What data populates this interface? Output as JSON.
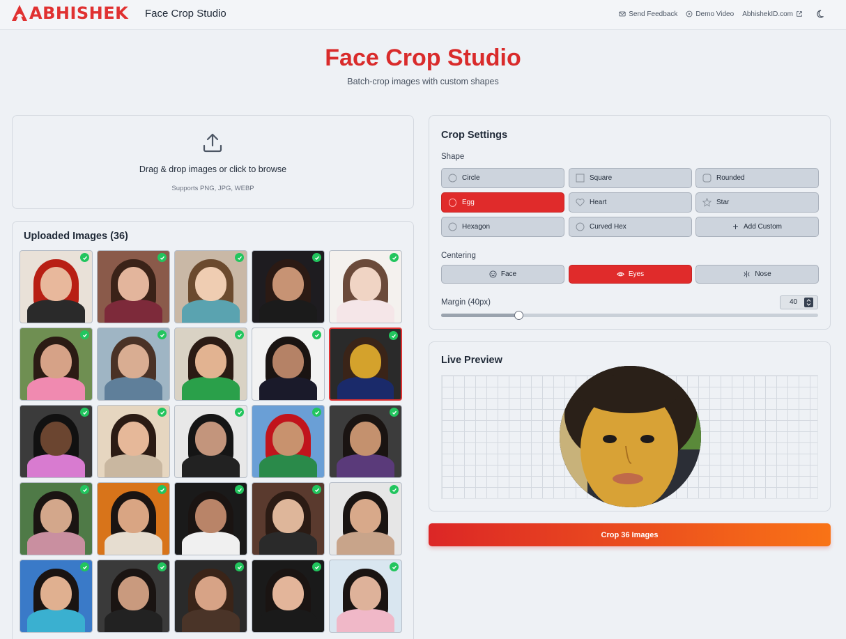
{
  "brand": {
    "logo_text": "ABHISHEK",
    "app_name": "Face Crop Studio"
  },
  "nav": {
    "feedback": "Send Feedback",
    "demo": "Demo Video",
    "site": "AbhishekID.com"
  },
  "hero": {
    "title": "Face Crop Studio",
    "subtitle": "Batch-crop images with custom shapes"
  },
  "upload": {
    "title": "Drag & drop images or click to browse",
    "subtitle": "Supports PNG, JPG, WEBP"
  },
  "gallery": {
    "title": "Uploaded Images (36)",
    "thumbnails": [
      {
        "bg": "#e9e1d8",
        "hair": "#b81f14",
        "skin": "#e8b89c",
        "shirt": "#2a2a2a"
      },
      {
        "bg": "#8a5a4a",
        "hair": "#3a2218",
        "skin": "#e3b59c",
        "shirt": "#7d2a3a"
      },
      {
        "bg": "#c9b8a6",
        "hair": "#6b4a2e",
        "skin": "#efcdb2",
        "shirt": "#5aa3b0"
      },
      {
        "bg": "#1e1c20",
        "hair": "#2b1a14",
        "skin": "#c79374",
        "shirt": "#1b1b1b"
      },
      {
        "bg": "#f4f1ee",
        "hair": "#6b4a3a",
        "skin": "#f0d4c4",
        "shirt": "#f5e6e8"
      },
      {
        "bg": "#6f8f52",
        "hair": "#2b1b14",
        "skin": "#d6a287",
        "shirt": "#f08ab0"
      },
      {
        "bg": "#9fb5c4",
        "hair": "#4a3226",
        "skin": "#d9ad92",
        "shirt": "#5f7f9a"
      },
      {
        "bg": "#d9d2c4",
        "hair": "#2b1b14",
        "skin": "#e2b391",
        "shirt": "#2aa04a"
      },
      {
        "bg": "#f2f2f2",
        "hair": "#1a1412",
        "skin": "#b58266",
        "shirt": "#1a1a2a"
      },
      {
        "bg": "#2a2a2a",
        "hair": "#3a2418",
        "skin": "#d4a22c",
        "shirt": "#1a2a6a"
      },
      {
        "bg": "#3b3b3b",
        "hair": "#111111",
        "skin": "#6b4530",
        "shirt": "#d87bd0"
      },
      {
        "bg": "#e6d6c0",
        "hair": "#2b1b14",
        "skin": "#e6b899",
        "shirt": "#c9b7a0"
      },
      {
        "bg": "#e8e8e8",
        "hair": "#151515",
        "skin": "#c3957c",
        "shirt": "#222222"
      },
      {
        "bg": "#6a9fd6",
        "hair": "#c1141c",
        "skin": "#c8926e",
        "shirt": "#2a8a4a"
      },
      {
        "bg": "#3c3c3c",
        "hair": "#1a1412",
        "skin": "#c4916e",
        "shirt": "#5a3a7a"
      },
      {
        "bg": "#4f7a47",
        "hair": "#1a1412",
        "skin": "#d3a78b",
        "shirt": "#c98fa0"
      },
      {
        "bg": "#d8741a",
        "hair": "#1a1412",
        "skin": "#d9a583",
        "shirt": "#e6ddd0"
      },
      {
        "bg": "#1a1a1a",
        "hair": "#1a1412",
        "skin": "#b98468",
        "shirt": "#f0f0f0"
      },
      {
        "bg": "#5a3a2e",
        "hair": "#2b1b14",
        "skin": "#deb69a",
        "shirt": "#2a2a2a"
      },
      {
        "bg": "#e6e6e6",
        "hair": "#1a1412",
        "skin": "#d8a98a",
        "shirt": "#c8a48a"
      },
      {
        "bg": "#3a7ac8",
        "hair": "#1a1412",
        "skin": "#e0b090",
        "shirt": "#3ab0d0"
      },
      {
        "bg": "#3a3a3a",
        "hair": "#1a1412",
        "skin": "#c99a7e",
        "shirt": "#222222"
      },
      {
        "bg": "#2a2a2a",
        "hair": "#3a2418",
        "skin": "#d7a386",
        "shirt": "#4a3428"
      },
      {
        "bg": "#1a1a1a",
        "hair": "#1a1412",
        "skin": "#e3b59a",
        "shirt": "#1a1a1a"
      },
      {
        "bg": "#d9e6f0",
        "hair": "#1a1412",
        "skin": "#deb29a",
        "shirt": "#f0b8c8"
      }
    ]
  },
  "settings": {
    "title": "Crop Settings",
    "shape_label": "Shape",
    "shapes": [
      {
        "label": "Circle"
      },
      {
        "label": "Square"
      },
      {
        "label": "Rounded"
      },
      {
        "label": "Egg"
      },
      {
        "label": "Heart"
      },
      {
        "label": "Star"
      },
      {
        "label": "Hexagon"
      },
      {
        "label": "Curved Hex"
      },
      {
        "label": "Add Custom"
      }
    ],
    "selected_shape": "Egg",
    "centering_label": "Centering",
    "centering": [
      {
        "label": "Face"
      },
      {
        "label": "Eyes"
      },
      {
        "label": "Nose"
      }
    ],
    "selected_centering": "Eyes",
    "margin_label": "Margin (40px)",
    "margin_value": "40",
    "margin_fraction": 0.2
  },
  "preview": {
    "title": "Live Preview"
  },
  "crop_button": "Crop 36 Images",
  "colors": {
    "accent": "#e02b2b",
    "gradient_end": "#f97316",
    "check": "#22c55e"
  }
}
